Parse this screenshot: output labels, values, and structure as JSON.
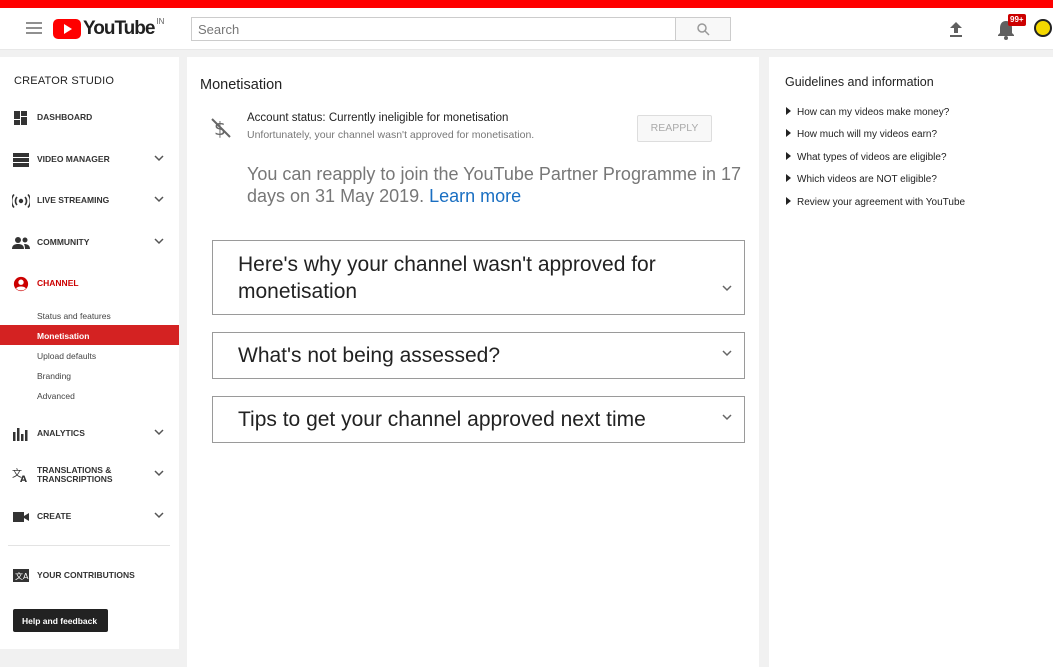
{
  "masthead": {
    "logo_text": "YouTube",
    "region": "IN",
    "search_placeholder": "Search",
    "notification_count": "99+"
  },
  "sidebar": {
    "header": "CREATOR STUDIO",
    "items": [
      {
        "label": "DASHBOARD",
        "icon": "dashboard-icon"
      },
      {
        "label": "VIDEO MANAGER",
        "icon": "video-manager-icon"
      },
      {
        "label": "LIVE STREAMING",
        "icon": "live-streaming-icon"
      },
      {
        "label": "COMMUNITY",
        "icon": "community-icon"
      },
      {
        "label": "CHANNEL",
        "icon": "channel-icon"
      },
      {
        "label": "ANALYTICS",
        "icon": "analytics-icon"
      },
      {
        "label_line1": "TRANSLATIONS &",
        "label_line2": "TRANSCRIPTIONS",
        "icon": "translate-icon"
      },
      {
        "label": "CREATE",
        "icon": "camera-icon"
      },
      {
        "label": "YOUR CONTRIBUTIONS",
        "icon": "contributions-icon"
      }
    ],
    "channel_subitems": [
      "Status and features",
      "Monetisation",
      "Upload defaults",
      "Branding",
      "Advanced"
    ],
    "active_subitem": "Monetisation",
    "help_button": "Help and feedback"
  },
  "main": {
    "title": "Monetisation",
    "account_status": "Account status: Currently ineligible for monetisation",
    "account_status_sub": "Unfortunately, your channel wasn't approved for monetisation.",
    "reapply_button": "REAPPLY",
    "reapply_note": "You can reapply to join the YouTube Partner Programme in 17 days on 31 May 2019.",
    "learn_more": "Learn more",
    "accordions": [
      {
        "line1": "Here's why your channel wasn't approved for",
        "line2": "monetisation"
      },
      {
        "line1": "What's not being assessed?"
      },
      {
        "line1": "Tips to get your channel approved next time"
      }
    ]
  },
  "right_panel": {
    "title": "Guidelines and information",
    "items": [
      "How can my videos make money?",
      "How much will my videos earn?",
      "What types of videos are eligible?",
      "Which videos are NOT eligible?",
      "Review your agreement with YouTube"
    ]
  },
  "colors": {
    "brand_red": "#ff0000",
    "active_red": "#d42222",
    "link_blue": "#1a6fc2"
  }
}
